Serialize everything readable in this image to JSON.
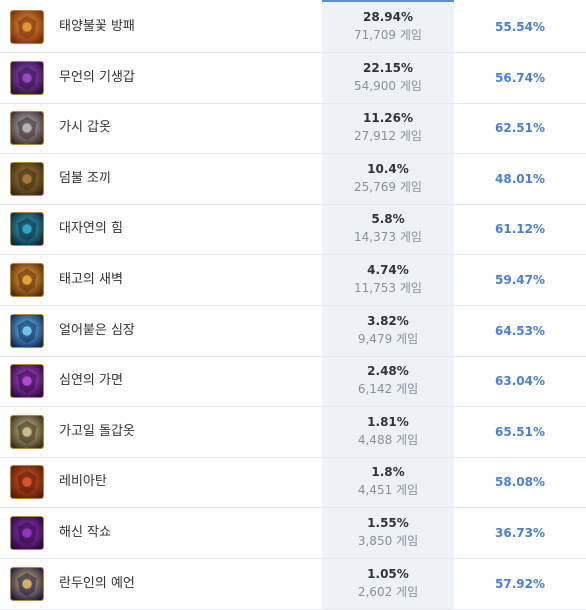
{
  "games_unit": "게임",
  "colors": {
    "winrate": "#4a7fd4",
    "pick_column_bg": "#eef2f7",
    "accent": "#5b8fd8"
  },
  "rows": [
    {
      "name": "태양불꽃 방패",
      "pick_rate": "28.94%",
      "games": "71,709",
      "win_rate": "55.54%",
      "icon": "sunfire-aegis-icon",
      "icon_colors": [
        "#7a2a0a",
        "#e8a23a"
      ]
    },
    {
      "name": "무언의 기생갑",
      "pick_rate": "22.15%",
      "games": "54,900",
      "win_rate": "56.74%",
      "icon": "unending-despair-icon",
      "icon_colors": [
        "#2a1040",
        "#a24fd0"
      ]
    },
    {
      "name": "가시 갑옷",
      "pick_rate": "11.26%",
      "games": "27,912",
      "win_rate": "62.51%",
      "icon": "thornmail-icon",
      "icon_colors": [
        "#3a2a2a",
        "#c0c0c8"
      ]
    },
    {
      "name": "덤불 조끼",
      "pick_rate": "10.4%",
      "games": "25,769",
      "win_rate": "48.01%",
      "icon": "bramble-vest-icon",
      "icon_colors": [
        "#3a2a14",
        "#b0823a"
      ]
    },
    {
      "name": "대자연의 힘",
      "pick_rate": "5.8%",
      "games": "14,373",
      "win_rate": "61.12%",
      "icon": "force-of-nature-icon",
      "icon_colors": [
        "#0a2a3a",
        "#3ab0d0"
      ]
    },
    {
      "name": "태고의 새벽",
      "pick_rate": "4.74%",
      "games": "11,753",
      "win_rate": "59.47%",
      "icon": "dawncore-icon",
      "icon_colors": [
        "#5a2a0a",
        "#f0b040"
      ]
    },
    {
      "name": "얼어붙은 심장",
      "pick_rate": "3.82%",
      "games": "9,479",
      "win_rate": "64.53%",
      "icon": "frozen-heart-icon",
      "icon_colors": [
        "#0a2a5a",
        "#7ad0ff"
      ]
    },
    {
      "name": "심연의 가면",
      "pick_rate": "2.48%",
      "games": "6,142",
      "win_rate": "63.04%",
      "icon": "abyssal-mask-icon",
      "icon_colors": [
        "#2a0a40",
        "#c050e0"
      ]
    },
    {
      "name": "가고일 돌갑옷",
      "pick_rate": "1.81%",
      "games": "4,488",
      "win_rate": "65.51%",
      "icon": "gargoyle-stoneplate-icon",
      "icon_colors": [
        "#3a3020",
        "#d8c890"
      ]
    },
    {
      "name": "레비아탄",
      "pick_rate": "1.8%",
      "games": "4,451",
      "win_rate": "58.08%",
      "icon": "leviathan-icon",
      "icon_colors": [
        "#5a1a0a",
        "#e05a2a"
      ]
    },
    {
      "name": "해신 작쇼",
      "pick_rate": "1.55%",
      "games": "3,850",
      "win_rate": "36.73%",
      "icon": "jaksho-icon",
      "icon_colors": [
        "#2a0a3a",
        "#9a3ad0"
      ]
    },
    {
      "name": "란두인의 예언",
      "pick_rate": "1.05%",
      "games": "2,602",
      "win_rate": "57.92%",
      "icon": "randuins-omen-icon",
      "icon_colors": [
        "#1a1a4a",
        "#e0c070"
      ]
    }
  ]
}
